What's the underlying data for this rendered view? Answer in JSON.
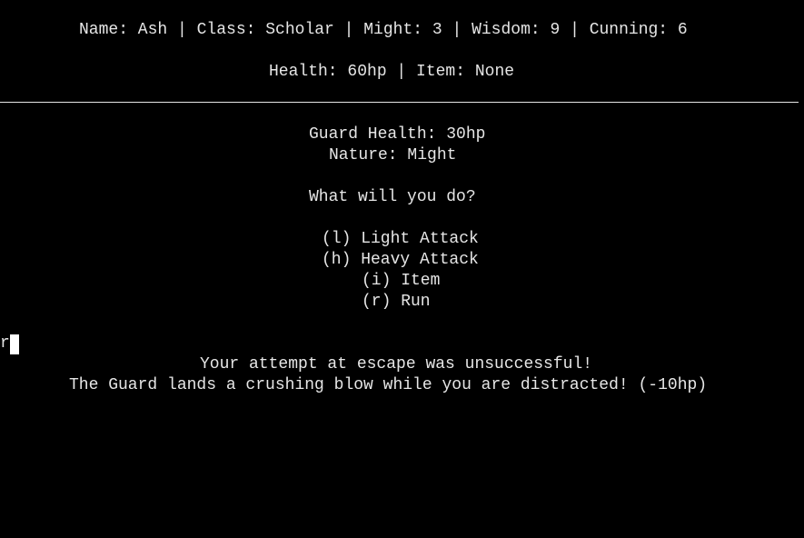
{
  "stats_bar": {
    "line1": "Name: Ash | Class: Scholar | Might: 3 | Wisdom: 9 | Cunning: 6",
    "line2": "Health: 60hp | Item: None"
  },
  "enemy": {
    "health": "Guard Health: 30hp",
    "nature": "Nature: Might"
  },
  "prompt": "What will you do?",
  "options": {
    "light": "(l) Light Attack",
    "heavy": "(h) Heavy Attack",
    "item": "(i) Item",
    "run": "(r) Run"
  },
  "input": {
    "typed": "r"
  },
  "messages": {
    "line1": "Your attempt at escape was unsuccessful!",
    "line2": "The Guard lands a crushing blow while you are distracted! (-10hp)"
  },
  "colors": {
    "background": "#000000",
    "text": "#e6e6e6",
    "cursor": "#ffffff"
  }
}
